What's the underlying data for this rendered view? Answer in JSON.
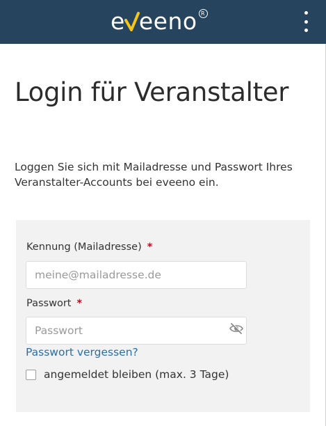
{
  "header": {
    "brand": "eveeno",
    "registered_mark": "R",
    "background": "#26445e",
    "accent": "#f5c518",
    "menu_icon": "kebab-menu-icon"
  },
  "page": {
    "title": "Login für Veranstalter",
    "intro": "Loggen Sie sich mit Mailadresse und Passwort Ihres Veranstalter-Accounts bei eveeno ein."
  },
  "form": {
    "id_label": "Kennung (Mailadresse)",
    "required_mark": "*",
    "id_placeholder": "meine@mailadresse.de",
    "id_value": "",
    "password_label": "Passwort",
    "password_placeholder": "Passwort",
    "password_value": "",
    "password_toggle_icon": "eye-slash-icon",
    "forgot_link": "Passwort vergessen?",
    "stay_logged_in_label": "angemeldet bleiben (max. 3 Tage)",
    "stay_logged_in_checked": false,
    "required_color": "#d0021b",
    "link_color": "#2a6fa8"
  }
}
